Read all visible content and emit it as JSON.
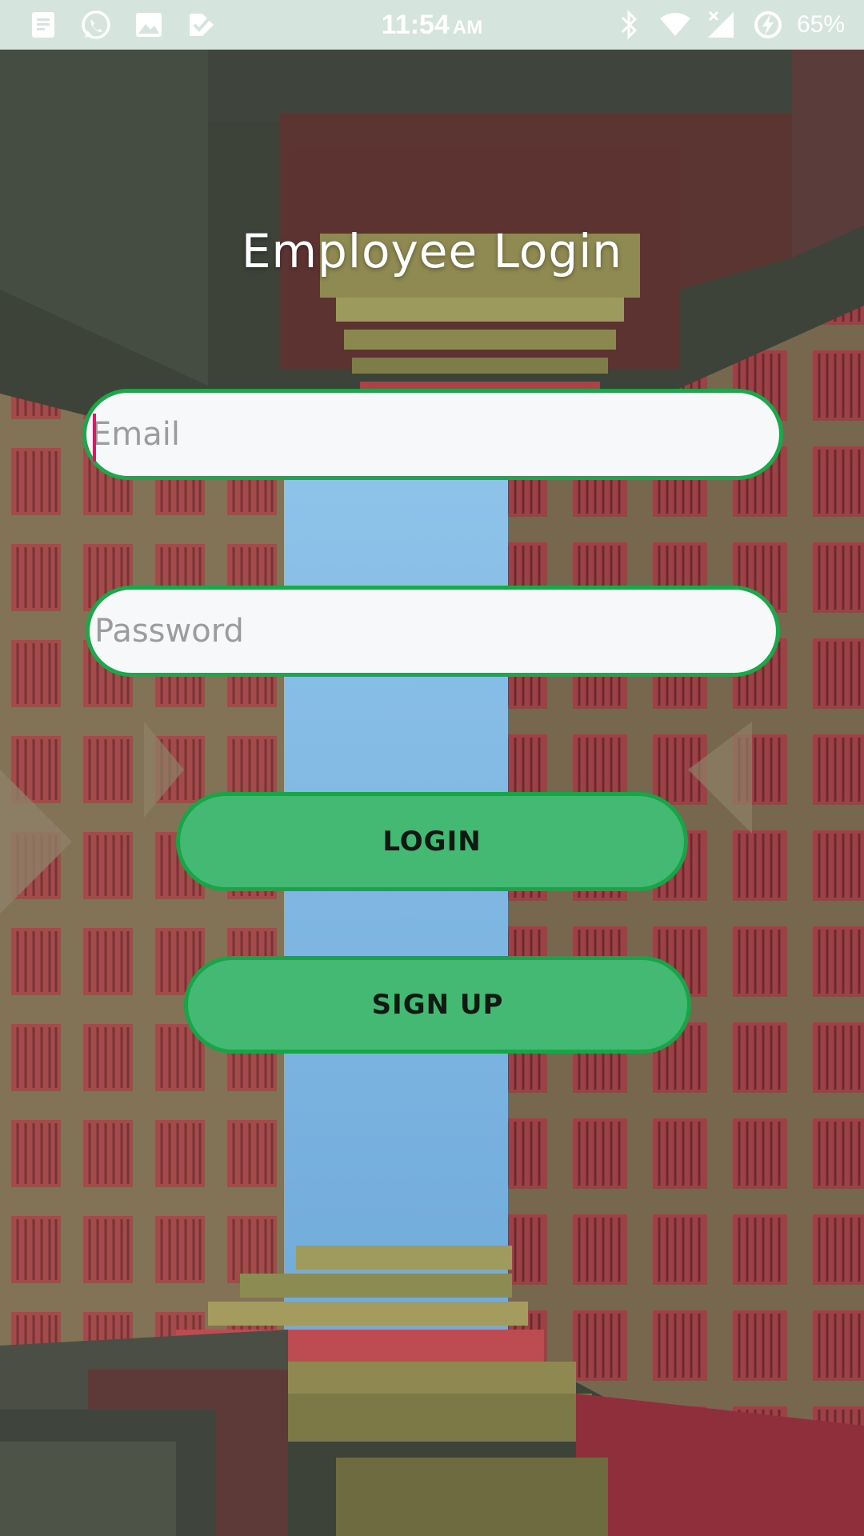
{
  "status_bar": {
    "time": "11:54",
    "ampm": "AM",
    "battery": "65%",
    "left_icons": [
      "notes-icon",
      "whatsapp-icon",
      "image-icon",
      "check-flag-icon"
    ],
    "right_icons": [
      "bluetooth-icon",
      "wifi-icon",
      "cellular-no-signal-icon",
      "battery-charging-icon"
    ]
  },
  "login": {
    "title": "Employee Login",
    "email_placeholder": "Email",
    "password_placeholder": "Password",
    "login_label": "LOGIN",
    "signup_label": "SIGN UP"
  },
  "colors": {
    "status_bar_bg": "#d5e5de",
    "field_border": "#1aa84a",
    "button_fill": "#43b974",
    "cursor": "#d81b60"
  }
}
